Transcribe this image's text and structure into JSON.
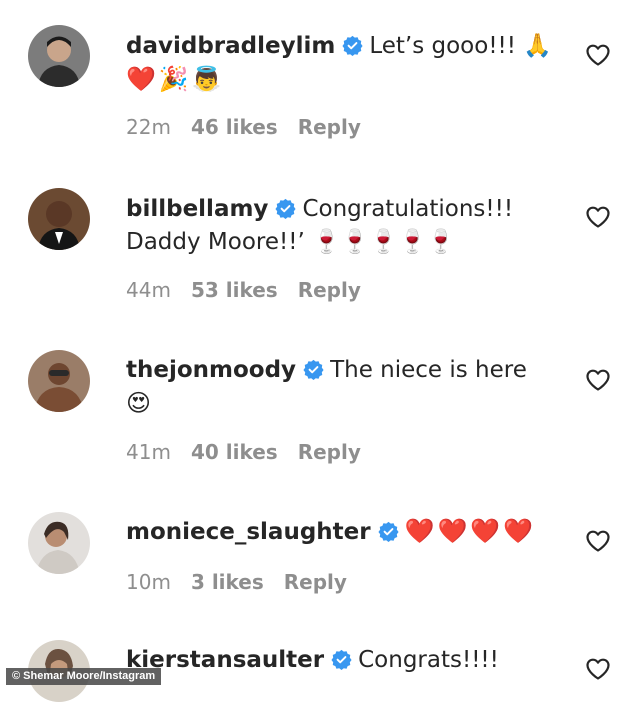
{
  "comments": [
    {
      "username": "davidbradleylim",
      "text": "Let’s gooo!!! 🙏",
      "text_line2": "❤️🎉👼",
      "time": "22m",
      "likes": "46 likes",
      "reply": "Reply"
    },
    {
      "username": "billbellamy",
      "text": "Congratulations!!!",
      "text_line2": "Daddy Moore!!’ 🍷🍷🍷🍷🍷",
      "time": "44m",
      "likes": "53 likes",
      "reply": "Reply"
    },
    {
      "username": "thejonmoody",
      "text": "The niece is here",
      "text_line2": "😍",
      "time": "41m",
      "likes": "40 likes",
      "reply": "Reply"
    },
    {
      "username": "moniece_slaughter",
      "text": "❤️❤️❤️❤️",
      "text_line2": "",
      "time": "10m",
      "likes": "3 likes",
      "reply": "Reply"
    },
    {
      "username": "kierstansaulter",
      "text": "Congrats!!!!",
      "text_line2": "",
      "time": "",
      "likes": "",
      "reply": ""
    }
  ],
  "credit": "© Shemar Moore/Instagram",
  "colors": {
    "verified": "#3897f0",
    "meta": "#8e8e8e",
    "text": "#262626"
  },
  "icons": {
    "verified": "verified-badge-icon",
    "like": "heart-outline-icon"
  }
}
